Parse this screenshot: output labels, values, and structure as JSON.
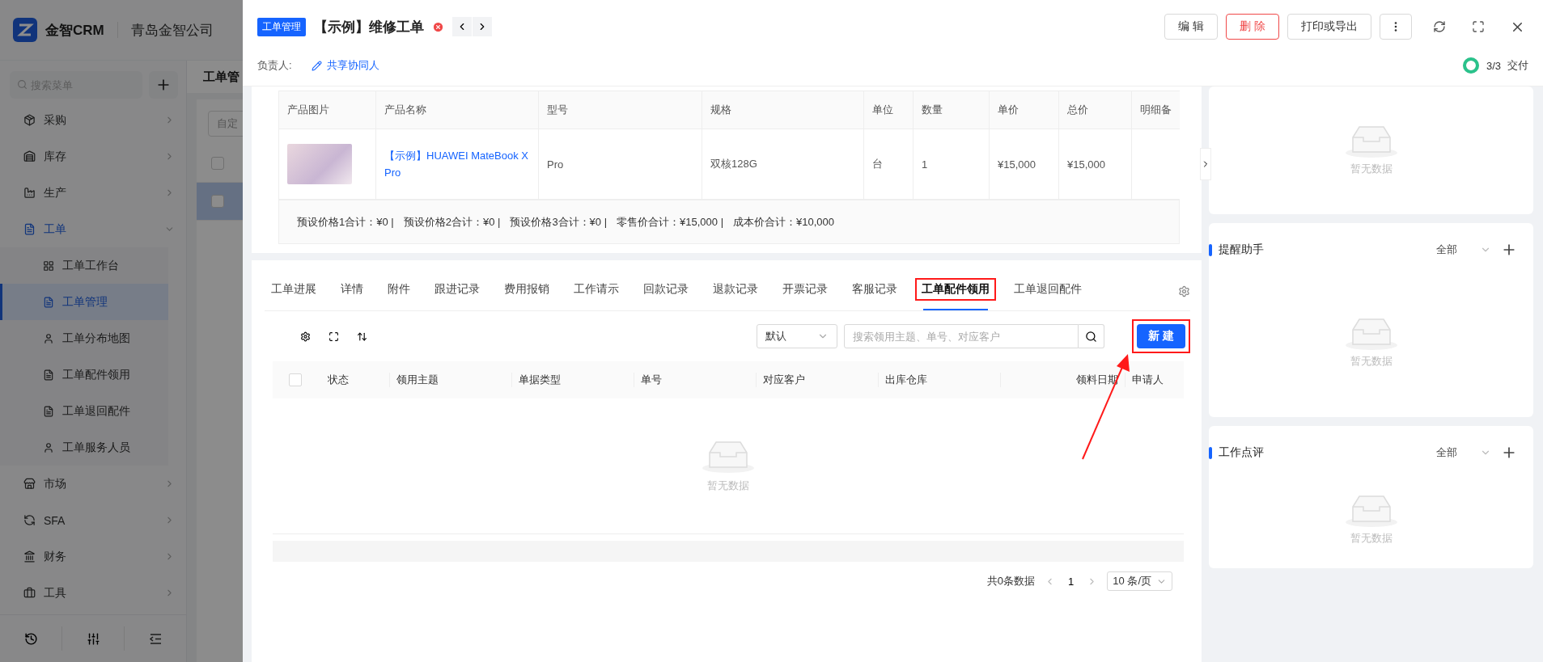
{
  "sidebar": {
    "brand": "金智CRM",
    "company": "青岛金智公司",
    "search": {
      "placeholder": "搜索菜单"
    },
    "items": [
      {
        "label": "采购",
        "expanded": false
      },
      {
        "label": "库存",
        "expanded": false
      },
      {
        "label": "生产",
        "expanded": false
      },
      {
        "label": "工单",
        "expanded": true,
        "children": [
          {
            "label": "工单工作台",
            "selected": false
          },
          {
            "label": "工单管理",
            "selected": true
          },
          {
            "label": "工单分布地图",
            "selected": false
          },
          {
            "label": "工单配件领用",
            "selected": false
          },
          {
            "label": "工单退回配件",
            "selected": false
          },
          {
            "label": "工单服务人员",
            "selected": false
          }
        ]
      },
      {
        "label": "市场",
        "expanded": false
      },
      {
        "label": "SFA",
        "expanded": false
      },
      {
        "label": "财务",
        "expanded": false
      },
      {
        "label": "工具",
        "expanded": false
      }
    ]
  },
  "background_page": {
    "title": "工单管",
    "button": "自定",
    "rows": [
      {
        "selected": false,
        "checked": false
      },
      {
        "selected": true,
        "checked": false
      }
    ]
  },
  "drawer": {
    "tag": "工单管理",
    "title": "【示例】维修工单",
    "actions": [
      {
        "label": "编 辑",
        "kind": "default"
      },
      {
        "label": "删 除",
        "kind": "danger"
      },
      {
        "label": "打印或导出",
        "kind": "default"
      }
    ],
    "owner_label": "负责人:",
    "share_link": "共享协同人",
    "progress": {
      "text": "3/3",
      "stage": "交付",
      "level": 1
    },
    "products": {
      "columns": [
        "产品图片",
        "产品名称",
        "型号",
        "规格",
        "单位",
        "数量",
        "单价",
        "总价",
        "明细备"
      ],
      "rows": [
        {
          "name": "【示例】HUAWEI MateBook X Pro",
          "model": "Pro",
          "spec": "双核128G",
          "unit": "台",
          "quantity": "1",
          "unit_price": "¥15,000",
          "total": "¥15,000"
        }
      ],
      "summary": [
        "预设价格1合计：¥0 |",
        "预设价格2合计：¥0 |",
        "预设价格3合计：¥0 |",
        "零售价合计：¥15,000 |",
        "成本价合计：¥10,000"
      ]
    },
    "tabs": [
      {
        "label": "工单进展",
        "selected": false,
        "highlighted": false
      },
      {
        "label": "详情",
        "selected": false,
        "highlighted": false
      },
      {
        "label": "附件",
        "selected": false,
        "highlighted": false
      },
      {
        "label": "跟进记录",
        "selected": false,
        "highlighted": false
      },
      {
        "label": "费用报销",
        "selected": false,
        "highlighted": false
      },
      {
        "label": "工作请示",
        "selected": false,
        "highlighted": false
      },
      {
        "label": "回款记录",
        "selected": false,
        "highlighted": false
      },
      {
        "label": "退款记录",
        "selected": false,
        "highlighted": false
      },
      {
        "label": "开票记录",
        "selected": false,
        "highlighted": false
      },
      {
        "label": "客服记录",
        "selected": false,
        "highlighted": false
      },
      {
        "label": "工单配件领用",
        "selected": true,
        "highlighted": true
      },
      {
        "label": "工单退回配件",
        "selected": false,
        "highlighted": false
      }
    ],
    "parts_table": {
      "view_select": "默认",
      "search": {
        "placeholder": "搜索领用主题、单号、对应客户"
      },
      "new_button": {
        "label": "新 建",
        "highlighted": true
      },
      "select_all_checked": false,
      "columns": [
        "状态",
        "领用主题",
        "单据类型",
        "单号",
        "对应客户",
        "出库仓库",
        "领料日期",
        "申请人"
      ],
      "empty_text": "暂无数据",
      "pagination": {
        "total": "共0条数据",
        "page": "1",
        "page_size": "10 条/页"
      }
    }
  },
  "right_panel": {
    "cards": [
      {
        "kind": "plain",
        "empty_text": "暂无数据"
      },
      {
        "kind": "titled",
        "title": "提醒助手",
        "filter": "全部",
        "empty_text": "暂无数据"
      },
      {
        "kind": "titled",
        "title": "工作点评",
        "filter": "全部",
        "empty_text": "暂无数据"
      }
    ]
  }
}
